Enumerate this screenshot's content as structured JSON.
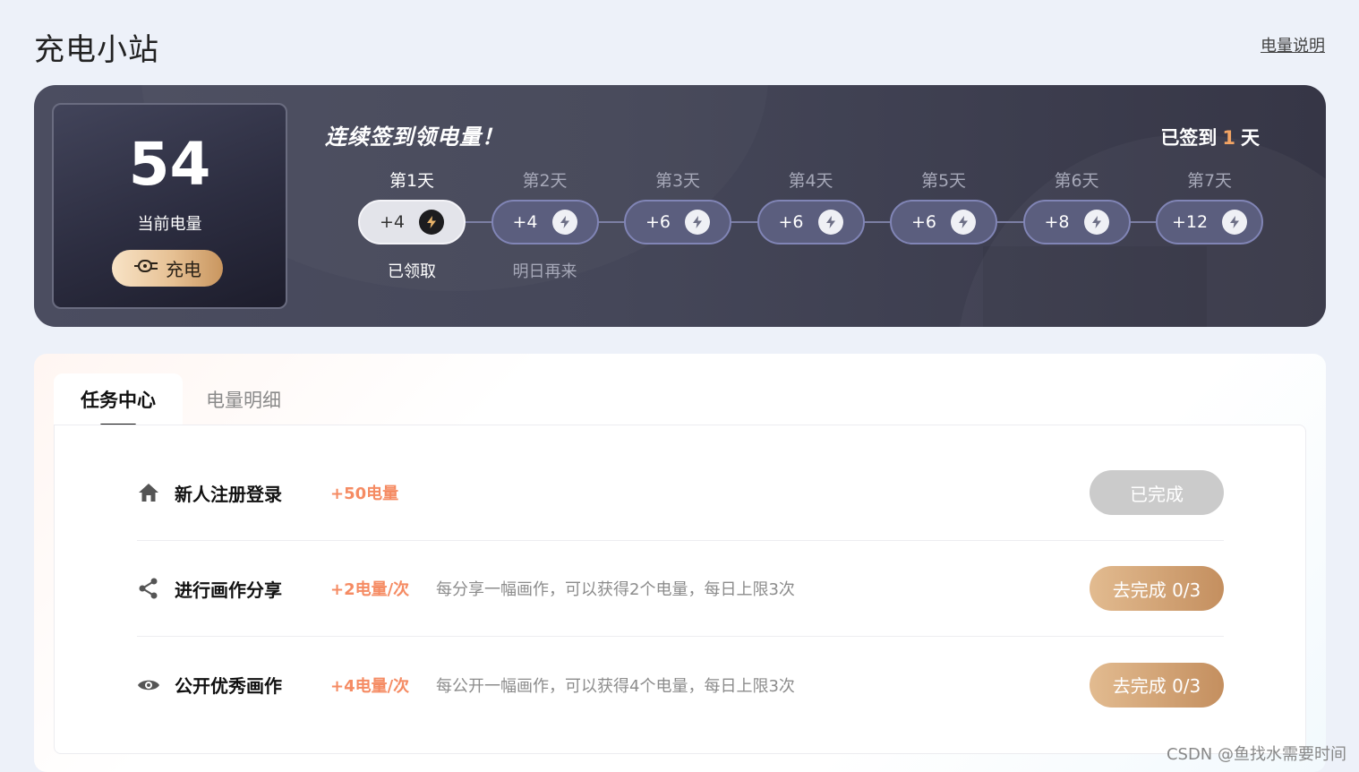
{
  "header": {
    "title": "充电小站",
    "help_link": "电量说明"
  },
  "energy": {
    "value": "54",
    "label": "当前电量",
    "charge_button": "充电"
  },
  "signin": {
    "title": "连续签到领电量！",
    "status_prefix": "已签到",
    "status_days": "1",
    "status_suffix": "天",
    "days": [
      {
        "label": "第1天",
        "reward": "+4",
        "note": "已领取",
        "active": true
      },
      {
        "label": "第2天",
        "reward": "+4",
        "note": "明日再来",
        "active": false
      },
      {
        "label": "第3天",
        "reward": "+6",
        "note": "",
        "active": false
      },
      {
        "label": "第4天",
        "reward": "+6",
        "note": "",
        "active": false
      },
      {
        "label": "第5天",
        "reward": "+6",
        "note": "",
        "active": false
      },
      {
        "label": "第6天",
        "reward": "+8",
        "note": "",
        "active": false
      },
      {
        "label": "第7天",
        "reward": "+12",
        "note": "",
        "active": false
      }
    ]
  },
  "tabs": [
    {
      "label": "任务中心",
      "active": true
    },
    {
      "label": "电量明细",
      "active": false
    }
  ],
  "tasks": [
    {
      "icon": "home-icon",
      "name": "新人注册登录",
      "reward": "+50电量",
      "desc": "",
      "button": "已完成",
      "done": true
    },
    {
      "icon": "share-icon",
      "name": "进行画作分享",
      "reward": "+2电量/次",
      "desc": "每分享一幅画作，可以获得2个电量，每日上限3次",
      "button": "去完成 0/3",
      "done": false
    },
    {
      "icon": "eye-icon",
      "name": "公开优秀画作",
      "reward": "+4电量/次",
      "desc": "每公开一幅画作，可以获得4个电量，每日上限3次",
      "button": "去完成 0/3",
      "done": false
    }
  ],
  "watermark": "CSDN @鱼找水需要时间",
  "colors": {
    "accent": "#f58b63",
    "gold_button": "#c48f5f",
    "banner_bg": "#454759",
    "page_bg": "#edf1f9"
  }
}
